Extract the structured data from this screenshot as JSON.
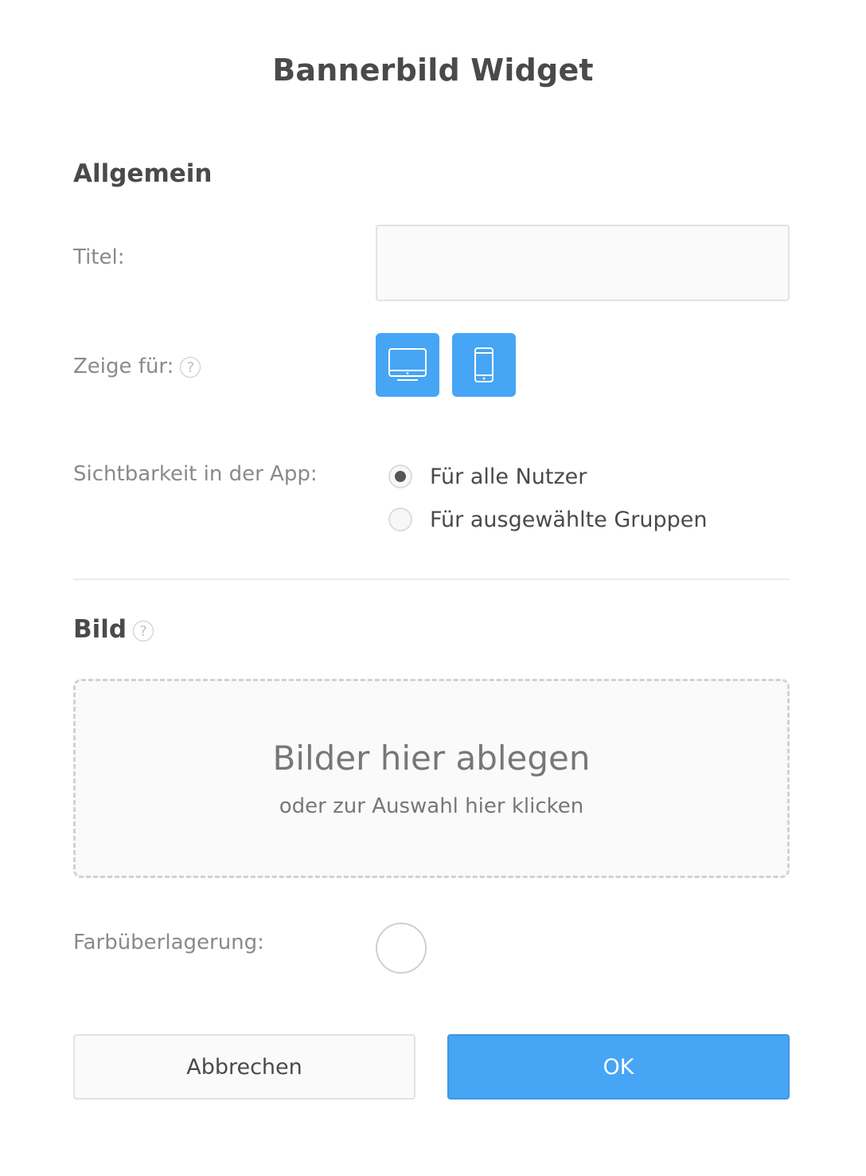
{
  "dialog": {
    "title": "Bannerbild Widget"
  },
  "general": {
    "heading": "Allgemein",
    "title_label": "Titel:",
    "title_value": "",
    "show_for_label": "Zeige für:",
    "help_glyph": "?",
    "devices": [
      {
        "name": "desktop",
        "icon": "desktop-monitor-icon",
        "active": true
      },
      {
        "name": "mobile",
        "icon": "smartphone-icon",
        "active": true
      }
    ],
    "visibility_label": "Sichtbarkeit in der App:",
    "visibility_options": [
      {
        "label": "Für alle Nutzer",
        "selected": true
      },
      {
        "label": "Für ausgewählte Gruppen",
        "selected": false
      }
    ]
  },
  "image": {
    "heading": "Bild",
    "help_glyph": "?",
    "dropzone_title": "Bilder hier ablegen",
    "dropzone_subtitle": "oder zur Auswahl hier klicken",
    "overlay_label": "Farbüberlagerung:",
    "overlay_color": "#ffffff"
  },
  "actions": {
    "cancel_label": "Abbrechen",
    "ok_label": "OK"
  },
  "colors": {
    "accent": "#46a5f4",
    "text": "#4a4a4a",
    "label": "#8a8a8a"
  }
}
